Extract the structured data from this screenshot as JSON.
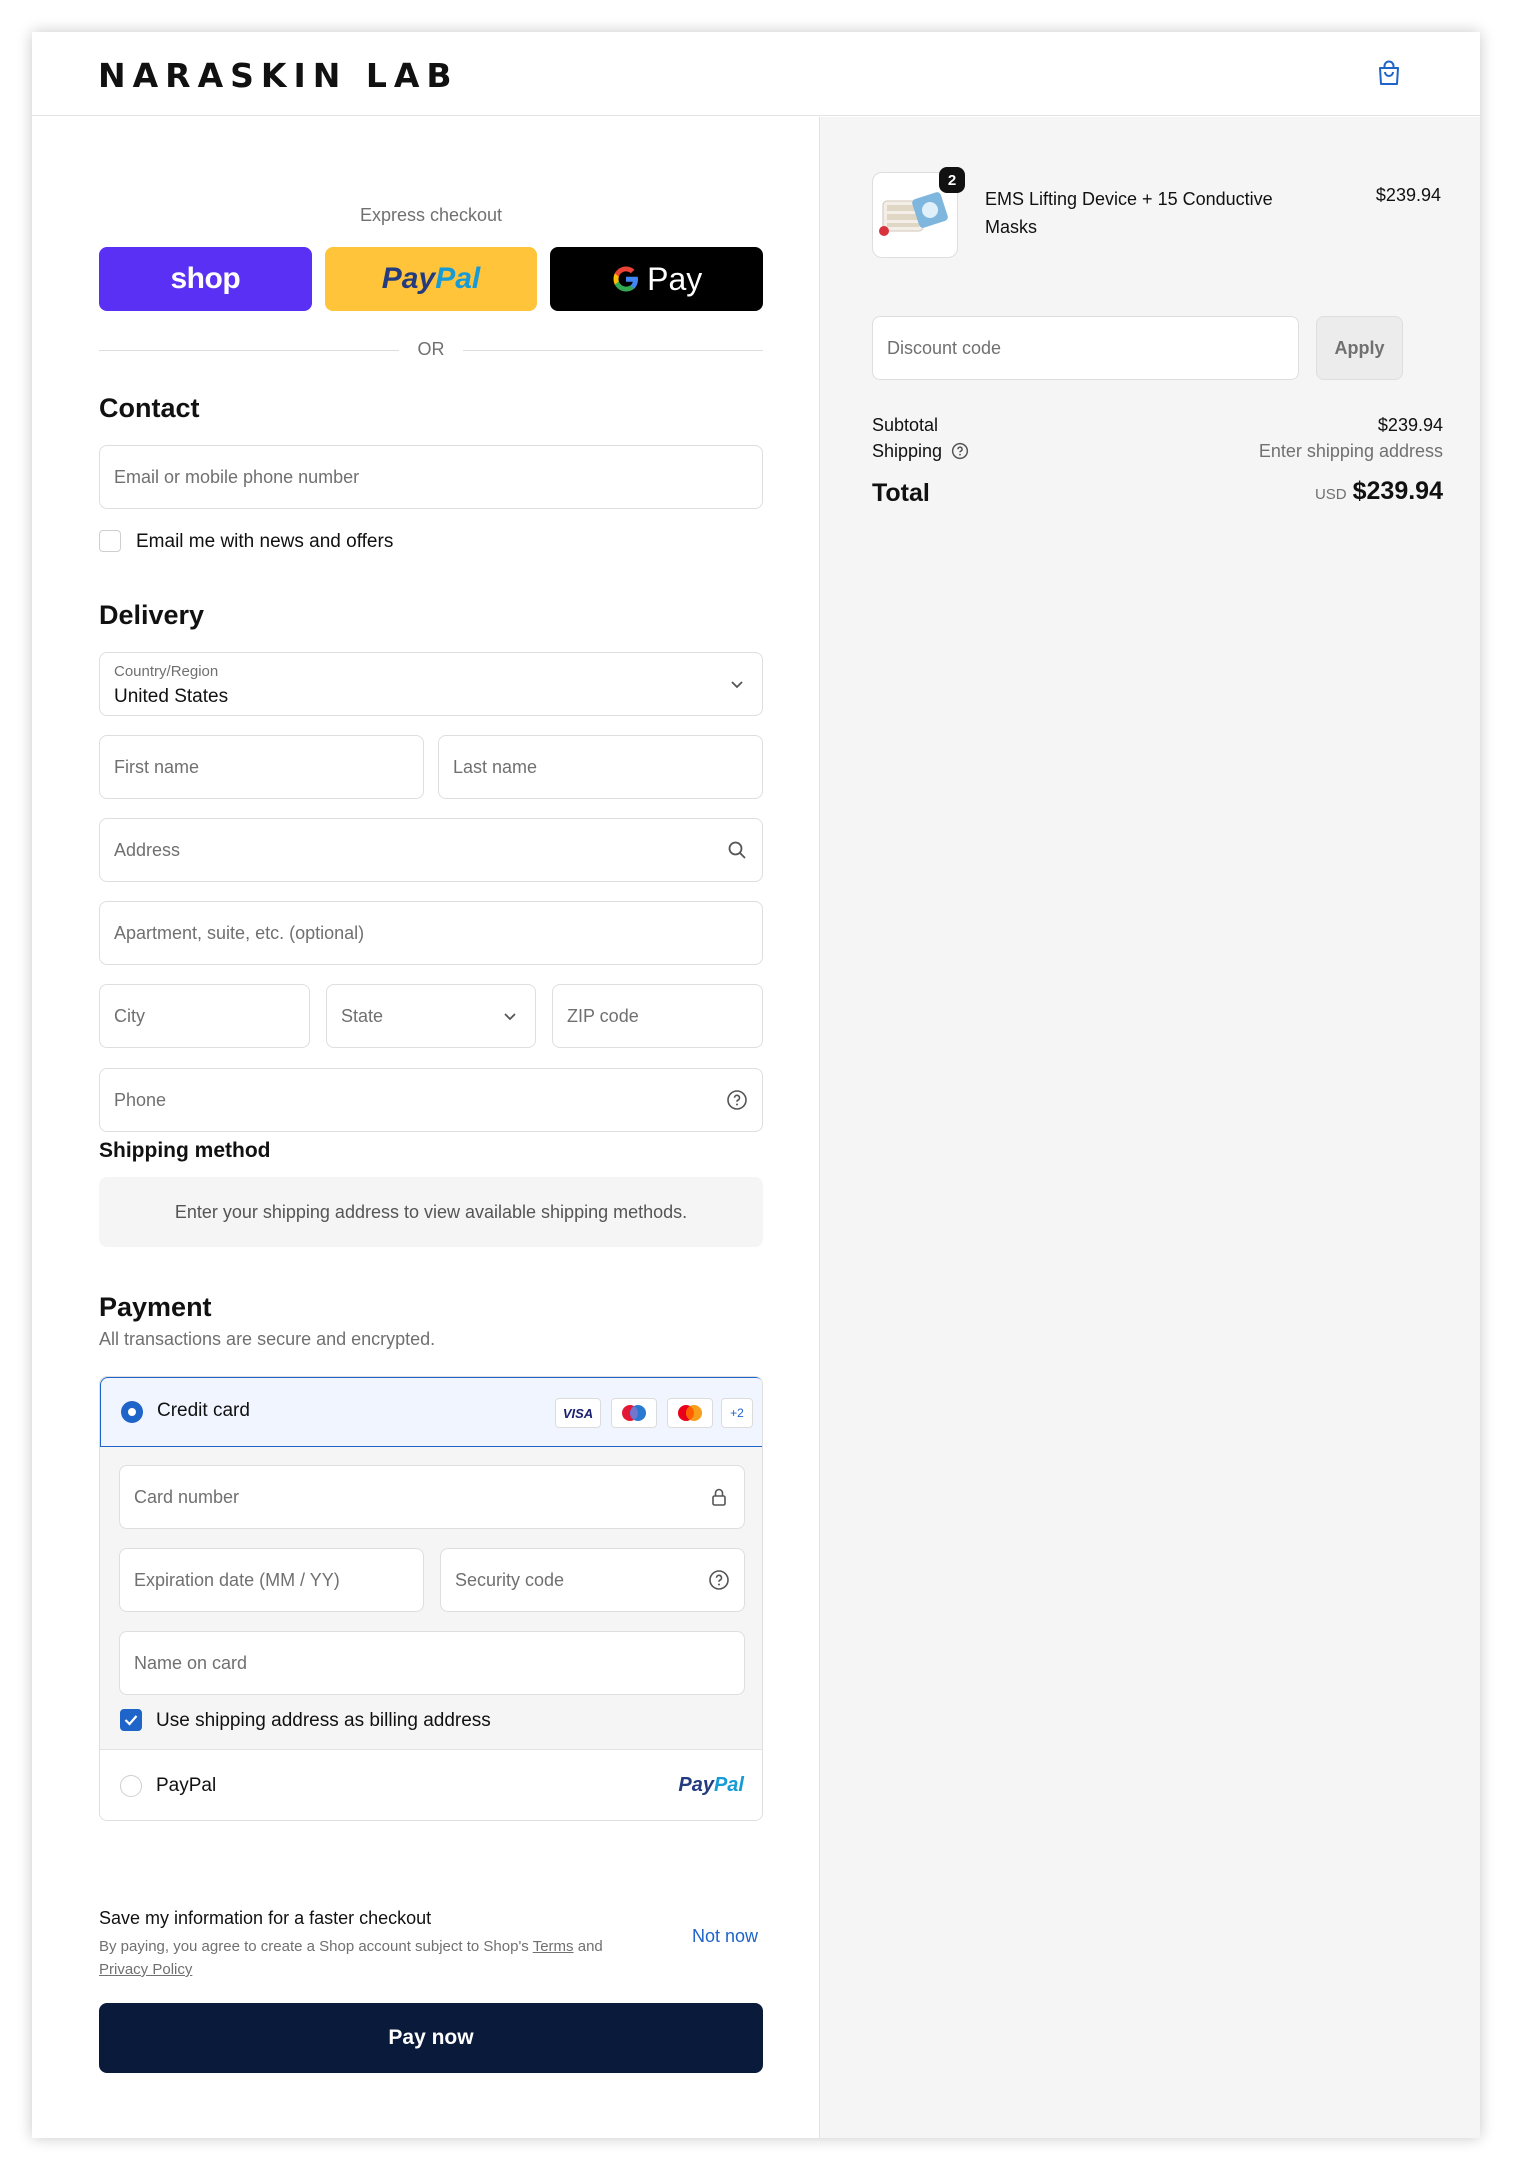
{
  "brand": {
    "name": "NARASKIN LAB"
  },
  "express": {
    "label": "Express checkout",
    "shop": "shop",
    "paypal_a": "Pay",
    "paypal_b": "Pal",
    "gpay": "Pay",
    "or": "OR"
  },
  "contact": {
    "title": "Contact",
    "email_placeholder": "Email or mobile phone number",
    "newsletter_label": "Email me with news and offers"
  },
  "delivery": {
    "title": "Delivery",
    "country_label": "Country/Region",
    "country_value": "United States",
    "first_name": "First name",
    "last_name": "Last name",
    "address": "Address",
    "apartment": "Apartment, suite, etc. (optional)",
    "city": "City",
    "state": "State",
    "zip": "ZIP code",
    "phone": "Phone"
  },
  "shipping": {
    "title": "Shipping method",
    "notice": "Enter your shipping address to view available shipping methods."
  },
  "payment": {
    "title": "Payment",
    "description": "All transactions are secure and encrypted.",
    "credit_card_label": "Credit card",
    "card_visa": "VISA",
    "card_more": "+2",
    "card_number": "Card number",
    "expiration": "Expiration date (MM / YY)",
    "security_code": "Security code",
    "name_on_card": "Name on card",
    "billing_same": "Use shipping address as billing address",
    "paypal_label": "PayPal",
    "paypal_logo_a": "Pay",
    "paypal_logo_b": "Pal"
  },
  "save_info": {
    "title": "Save my information for a faster checkout",
    "sub_prefix": "By paying, you agree to create a Shop account subject to Shop's ",
    "terms": "Terms",
    "and": " and",
    "privacy": "Privacy Policy",
    "not_now": "Not now"
  },
  "pay_now": "Pay now",
  "summary": {
    "product_name": "EMS Lifting Device + 15 Conductive Masks",
    "product_qty": "2",
    "product_price": "$239.94",
    "discount_placeholder": "Discount code",
    "apply": "Apply",
    "subtotal_label": "Subtotal",
    "subtotal_value": "$239.94",
    "shipping_label": "Shipping",
    "shipping_value": "Enter shipping address",
    "total_label": "Total",
    "total_currency": "USD",
    "total_value": "$239.94"
  },
  "colors": {
    "accent": "#1f64c8",
    "shop_purple": "#5a31f4",
    "paypal_yellow": "#ffc439",
    "pay_now_navy": "#0a1a3a"
  },
  "icons": [
    "bag-icon",
    "chevron-down-icon",
    "search-icon",
    "help-circle-icon",
    "lock-icon",
    "google-g-icon",
    "maestro-icon",
    "mastercard-icon",
    "check-icon"
  ]
}
